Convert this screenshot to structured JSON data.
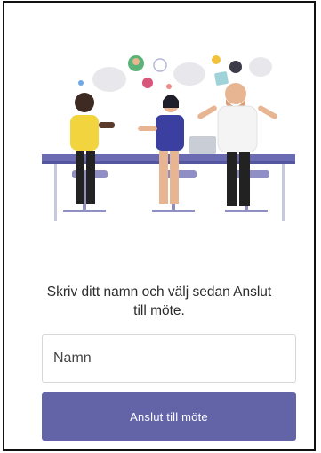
{
  "prompt": {
    "line1": "Skriv ditt namn och välj sedan Anslut",
    "line2": "till möte."
  },
  "name_input": {
    "placeholder": "Namn",
    "value": ""
  },
  "join_button": {
    "label": "Anslut till möte"
  },
  "colors": {
    "accent": "#6264a7",
    "table": "#6b6bb3",
    "chairs": "#8f8fc6"
  }
}
